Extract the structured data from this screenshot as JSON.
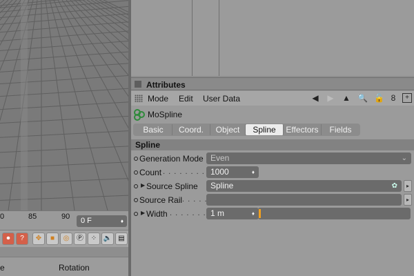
{
  "viewport": {
    "label": "3D viewport"
  },
  "timeline": {
    "ticks": [
      "0",
      "85",
      "90"
    ],
    "frame_value": "0 F",
    "frame_arrows": "♦"
  },
  "toolbar": {
    "icons": [
      "record-icon",
      "autokey-icon",
      "move-key-icon",
      "scale-key-icon",
      "rotation-key-icon",
      "param-key-icon",
      "pla-key-icon",
      "sound-icon",
      "document-icon"
    ]
  },
  "coord_header": {
    "col1": "e",
    "col2": "Rotation"
  },
  "attributes": {
    "title": "Attributes",
    "menu": {
      "mode": "Mode",
      "edit": "Edit",
      "user_data": "User Data"
    },
    "object_name": "MoSpline",
    "tabs": [
      {
        "label": "Basic",
        "active": false
      },
      {
        "label": "Coord.",
        "active": false
      },
      {
        "label": "Object",
        "active": false
      },
      {
        "label": "Spline",
        "active": true
      },
      {
        "label": "Effectors",
        "active": false
      },
      {
        "label": "Fields",
        "active": false
      }
    ],
    "section": "Spline",
    "params": {
      "generation_mode": {
        "label": "Generation Mode",
        "value": "Even"
      },
      "count": {
        "label": "Count",
        "leader": ". . . . . . . . .",
        "value": "1000"
      },
      "source_spline": {
        "label": "Source Spline",
        "value": "Spline"
      },
      "source_rail": {
        "label": "Source Rail",
        "leader": ". . . . . .",
        "value": ""
      },
      "width": {
        "label": "Width",
        "leader": ". . . . . . . . .",
        "value": "1 m"
      }
    }
  },
  "colors": {
    "accent": "#f0a020",
    "panel": "#9b9b9b",
    "field": "#6b6b6b"
  }
}
